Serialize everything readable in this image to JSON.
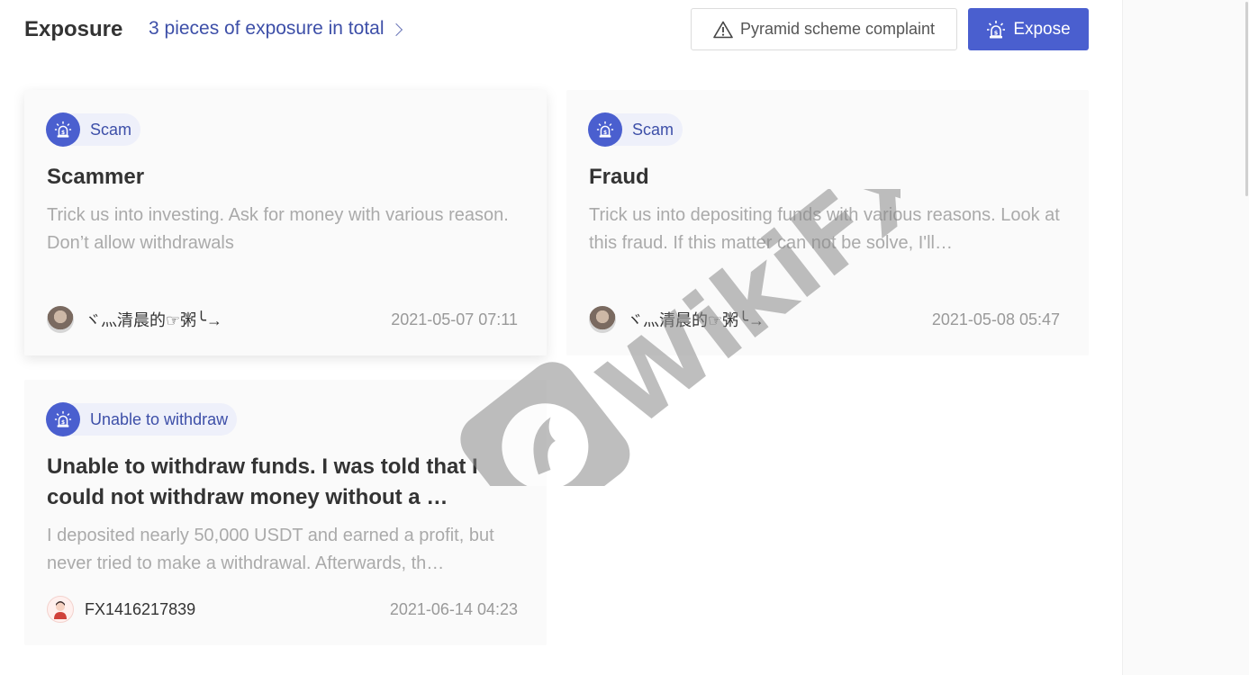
{
  "header": {
    "title": "Exposure",
    "total_link": "3 pieces of exposure in total",
    "pyramid_button": "Pyramid scheme complaint",
    "expose_button": "Expose"
  },
  "watermark": {
    "text": "WikiFX"
  },
  "cards": [
    {
      "tag": "Scam",
      "title": "Scammer",
      "description": "Trick us into investing. Ask for money with various reason. Don’t allow withdrawals",
      "author": "ヾ灬清晨的☞粥╰→",
      "date": "2021-05-07 07:11"
    },
    {
      "tag": "Scam",
      "title": "Fraud",
      "description": "Trick us into depositing funds with various reasons. Look at this fraud. If this matter can not be solve, I'll…",
      "author": "ヾ灬清晨的☞粥╰→",
      "date": "2021-05-08 05:47"
    },
    {
      "tag": "Unable to withdraw",
      "title": "Unable to withdraw funds. I was told that I could not withdraw money without a …",
      "description": "I deposited nearly 50,000 USDT and earned a profit, but never tried to make a withdrawal. Afterwards, th…",
      "author": "FX1416217839",
      "date": "2021-06-14 04:23"
    }
  ],
  "colors": {
    "accent": "#4a5fcf",
    "link": "#3d4fa8",
    "tag_bg": "#eef0fa",
    "muted": "#aaaaaa"
  },
  "icons": {
    "warning": "warning-triangle-icon",
    "expose": "alarm-light-icon",
    "tag": "alarm-light-icon"
  }
}
